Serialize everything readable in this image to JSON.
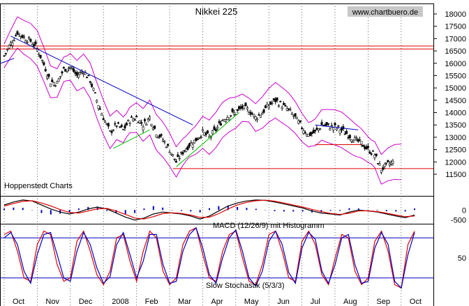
{
  "chart_data": [
    {
      "type": "candlestick",
      "title": "Nikkei 225",
      "source_badge": "www.chartbuero.de",
      "watermark": "Hoppenstedt Charts",
      "ylim": [
        11500,
        18000
      ],
      "y_ticks": [
        "18000",
        "17500",
        "17000",
        "16500",
        "16000",
        "15500",
        "15000",
        "14500",
        "14000",
        "13500",
        "13000",
        "12500",
        "12000",
        "11500"
      ],
      "x_ticks": [
        "Oct",
        "Nov",
        "Dec",
        "2008",
        "Feb",
        "Mar",
        "Apr",
        "May",
        "Jun",
        "Jul",
        "Aug",
        "Sep",
        "Oct"
      ],
      "x_tick_month_index": [
        0,
        1,
        2,
        3,
        4,
        5,
        6,
        7,
        8,
        9,
        10,
        11,
        12
      ],
      "price_path": [
        [
          0.0,
          16300
        ],
        [
          0.2,
          16800
        ],
        [
          0.4,
          17250
        ],
        [
          0.6,
          17050
        ],
        [
          0.8,
          16900
        ],
        [
          1.0,
          16600
        ],
        [
          1.2,
          15950
        ],
        [
          1.4,
          15250
        ],
        [
          1.6,
          15200
        ],
        [
          1.8,
          15750
        ],
        [
          2.0,
          15850
        ],
        [
          2.2,
          15500
        ],
        [
          2.4,
          15700
        ],
        [
          2.6,
          15300
        ],
        [
          2.8,
          14500
        ],
        [
          3.0,
          13800
        ],
        [
          3.2,
          13200
        ],
        [
          3.4,
          13500
        ],
        [
          3.6,
          13300
        ],
        [
          3.8,
          13700
        ],
        [
          4.0,
          13800
        ],
        [
          4.2,
          13500
        ],
        [
          4.4,
          13800
        ],
        [
          4.6,
          13200
        ],
        [
          4.8,
          12900
        ],
        [
          5.0,
          12500
        ],
        [
          5.2,
          12000
        ],
        [
          5.4,
          12400
        ],
        [
          5.6,
          12700
        ],
        [
          5.8,
          12900
        ],
        [
          6.0,
          13200
        ],
        [
          6.2,
          13000
        ],
        [
          6.4,
          13300
        ],
        [
          6.6,
          13700
        ],
        [
          6.8,
          13900
        ],
        [
          7.0,
          14000
        ],
        [
          7.2,
          14200
        ],
        [
          7.4,
          14100
        ],
        [
          7.6,
          13800
        ],
        [
          7.8,
          14000
        ],
        [
          8.0,
          14300
        ],
        [
          8.2,
          14500
        ],
        [
          8.4,
          14300
        ],
        [
          8.6,
          14100
        ],
        [
          8.8,
          13800
        ],
        [
          9.0,
          13400
        ],
        [
          9.2,
          13100
        ],
        [
          9.4,
          13200
        ],
        [
          9.6,
          13500
        ],
        [
          9.8,
          13450
        ],
        [
          10.0,
          13400
        ],
        [
          10.2,
          13300
        ],
        [
          10.4,
          13100
        ],
        [
          10.6,
          12900
        ],
        [
          10.8,
          12750
        ],
        [
          11.0,
          12500
        ],
        [
          11.2,
          12300
        ],
        [
          11.4,
          11700
        ],
        [
          11.6,
          11900
        ],
        [
          11.8,
          12000
        ]
      ],
      "bollinger_half_width": 600,
      "horizontal_lines": [
        {
          "value": 16700,
          "color": "#e00000"
        },
        {
          "value": 16580,
          "color": "#e00000"
        },
        {
          "value": 11730,
          "color": "#e00000"
        },
        {
          "value": 12700,
          "color": "#e00000"
        }
      ],
      "trendlines": [
        {
          "from": [
            0.2,
            17100
          ],
          "to": [
            5.7,
            13500
          ],
          "color": "#0000c0"
        },
        {
          "from": [
            9.4,
            13500
          ],
          "to": [
            10.7,
            13300
          ],
          "color": "#0000c0"
        },
        {
          "from": [
            3.3,
            12550
          ],
          "to": [
            4.4,
            13300
          ],
          "color": "#00c000"
        },
        {
          "from": [
            5.2,
            11800
          ],
          "to": [
            7.1,
            14000
          ],
          "color": "#00c000"
        },
        {
          "from": [
            -0.1,
            16000
          ],
          "to": [
            0.3,
            16200
          ],
          "color": "#0000c0"
        }
      ],
      "colors": {
        "price": "#000000",
        "bands": "#cc00cc",
        "support": "#e00000"
      }
    },
    {
      "type": "line",
      "label": "MACD (12/26/9) mit Histogramm",
      "y_ticks": [
        "0",
        "-500"
      ],
      "series": [
        {
          "color": "#000000",
          "values": [
            250,
            400,
            500,
            450,
            250,
            50,
            -100,
            -200,
            -100,
            50,
            150,
            50,
            -150,
            -350,
            -500,
            -400,
            -200,
            -100,
            -150,
            -200,
            -300,
            -450,
            -300,
            -50,
            200,
            350,
            450,
            500,
            480,
            400,
            300,
            200,
            100,
            -50,
            -150,
            -200,
            -250,
            -100,
            0,
            -50,
            -100,
            -200,
            -300,
            -380,
            -250
          ]
        },
        {
          "color": "#e00000",
          "values": [
            200,
            320,
            430,
            460,
            350,
            200,
            20,
            -120,
            -150,
            -50,
            60,
            80,
            -50,
            -220,
            -400,
            -450,
            -330,
            -180,
            -140,
            -170,
            -250,
            -370,
            -360,
            -180,
            50,
            250,
            380,
            460,
            490,
            440,
            350,
            250,
            150,
            30,
            -80,
            -170,
            -220,
            -160,
            -50,
            -40,
            -80,
            -160,
            -250,
            -330,
            -300
          ]
        }
      ],
      "histogram_color": "#0000c0"
    },
    {
      "type": "line",
      "label": "Slow Stochastik (5/3/3)",
      "y_ticks": [
        "50"
      ],
      "bands": [
        80,
        20
      ],
      "series": [
        {
          "color": "#e00000",
          "values": [
            85,
            90,
            60,
            20,
            15,
            70,
            90,
            85,
            40,
            15,
            20,
            75,
            90,
            60,
            25,
            10,
            30,
            80,
            85,
            45,
            15,
            60,
            90,
            80,
            30,
            10,
            20,
            70,
            90,
            95,
            55,
            20,
            15,
            60,
            85,
            90,
            50,
            15,
            10,
            40,
            85,
            90,
            60,
            20,
            15,
            75,
            90,
            70,
            25,
            10,
            50,
            85,
            80,
            30,
            10,
            20,
            75,
            90,
            60,
            10,
            5,
            70,
            90
          ]
        },
        {
          "color": "#0000c0",
          "values": [
            80,
            88,
            70,
            30,
            12,
            55,
            85,
            88,
            55,
            20,
            15,
            60,
            88,
            70,
            35,
            12,
            22,
            70,
            88,
            55,
            20,
            45,
            85,
            85,
            40,
            12,
            15,
            60,
            85,
            95,
            65,
            25,
            12,
            50,
            80,
            92,
            60,
            20,
            8,
            30,
            75,
            90,
            70,
            28,
            12,
            65,
            88,
            78,
            30,
            12,
            40,
            80,
            85,
            40,
            12,
            15,
            65,
            88,
            70,
            15,
            5,
            55,
            88
          ]
        }
      ]
    }
  ]
}
